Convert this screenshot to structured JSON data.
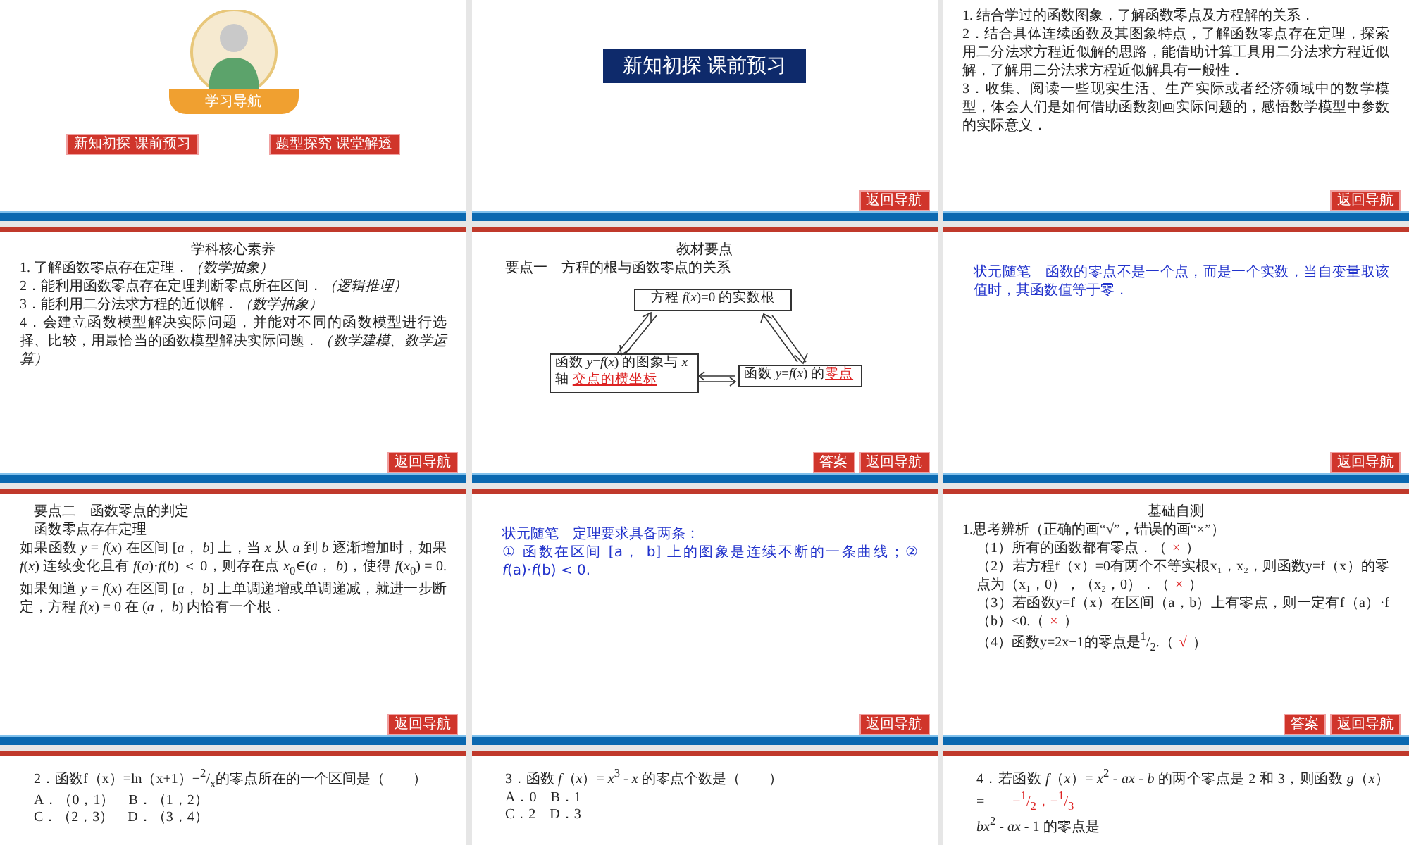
{
  "slides": [
    {
      "kind": "cover",
      "banner": "学习导航",
      "links": [
        "新知初探  课前预习",
        "题型探究  课堂解透"
      ]
    },
    {
      "kind": "section",
      "title": "新知初探  课前预习",
      "nav": "返回导航"
    },
    {
      "kind": "text",
      "lines": [
        "1. 结合学过的函数图象，了解函数零点及方程解的关系．",
        "2．结合具体连续函数及其图象特点，了解函数零点存在定理，探索用二分法求方程近似解的思路，能借助计算工具用二分法求方程近似解，了解用二分法求方程近似解具有一般性．",
        "3．收集、阅读一些现实生活、生产实际或者经济领域中的数学模型，体会人们是如何借助函数刻画实际问题的，感悟数学模型中参数的实际意义．"
      ],
      "nav": "返回导航"
    },
    {
      "kind": "text",
      "title": "学科核心素养",
      "lines": [
        "1. 了解函数零点存在定理．*（数学抽象）*",
        "2．能利用函数零点存在定理判断零点所在区间．*（逻辑推理）*",
        "3．能利用二分法求方程的近似解．*（数学抽象）*",
        "4．会建立函数模型解决实际问题，并能对不同的函数模型进行选择、比较，用最恰当的函数模型解决实际问题．*（数学建模、数学运算）*"
      ],
      "nav": "返回导航"
    },
    {
      "kind": "diagram",
      "title": "教材要点",
      "heading": "要点一　方程的根与函数零点的关系",
      "diagram": {
        "top": "方程 *f*(*x*)=0 的实数根",
        "left": "函数 *y*=*f*(*x*) 的图象与 *x* 轴",
        "left_answer": "交点的横坐标",
        "right": "函数 *y*=*f*(*x*) 的",
        "right_answer": "零点"
      },
      "answer": "答案",
      "nav": "返回导航"
    },
    {
      "kind": "note",
      "lines": [
        "状元随笔　函数的零点不是一个点，而是一个实数，当自变量取该值时，其函数值等于零．"
      ],
      "nav": "返回导航"
    },
    {
      "kind": "text",
      "headings": [
        "要点二　函数零点的判定",
        "函数零点存在定理"
      ],
      "lines": [
        "如果函数 *y* = *f*(*x*) 在区间 [*a*， *b*] 上，当 *x* 从 *a* 到 *b* 逐渐增加时，如果 *f*(*x*) 连续变化且有 *f*(*a*)·*f*(*b*) ＜ 0，则存在点 *x*$_{0}$∈(*a*， *b*)，使得 *f*(*x*$_{0}$) = 0. 如果知道 *y* = *f*(*x*) 在区间 [*a*， *b*] 上单调递增或单调递减，就进一步断定，方程 *f*(*x*) = 0 在 (*a*， *b*) 内恰有一个根．"
      ],
      "nav": "返回导航"
    },
    {
      "kind": "note",
      "lines": [
        "状元随笔　定理要求具备两条：",
        "① 函数在区间 [a， b] 上的图象是连续不断的一条曲线；② *f*(a)·*f*(b) < 0."
      ],
      "nav": "返回导航"
    },
    {
      "kind": "quiz",
      "title": "基础自测",
      "intro": "1.思考辨析（正确的画“√”，错误的画“×”）",
      "items": [
        {
          "before": "（1）所有的函数都有零点．（",
          "mark": "×",
          "after": "）"
        },
        {
          "before": "（2）若方程f（x）=0有两个不等实根x₁，x₂，则函数y=f（x）的零点为（x₁，0），（x₂，0）．（",
          "mark": "×",
          "after": "）"
        },
        {
          "before": "（3）若函数y=f（x）在区间（a，b）上有零点，则一定有f（a）·f（b）<0.（",
          "mark": "×",
          "after": "）"
        },
        {
          "before": "（4）函数y=2x−1的零点是$^{1}$/$_{2}$.（",
          "mark": "√",
          "after": "）"
        }
      ],
      "answer": "答案",
      "nav": "返回导航"
    },
    {
      "kind": "question",
      "lines": [
        "2．函数f（x）=ln（x+1）−$^{2}$/$_{x}$的零点所在的一个区间是（　　）",
        "A．（0，1）　B．（1，2）",
        "C．（2，3）　D．（3，4）"
      ]
    },
    {
      "kind": "question",
      "lines": [
        "3．函数 *f*（*x*）= *x*$^{3}$ - *x* 的零点个数是（　　）",
        "A．0　B．1",
        "C．2　D．3"
      ]
    },
    {
      "kind": "question",
      "lines": [
        "4．若函数 *f*（*x*）= *x*$^{2}$ - *ax* - *b* 的两个零点是 2 和 3，则函数 *g*（*x*）=",
        "*bx*$^{2}$ - *ax* - 1 的零点是"
      ],
      "answer_text": "−$^{1}$/$_{2}$，−$^{1}$/$_{3}$"
    }
  ]
}
